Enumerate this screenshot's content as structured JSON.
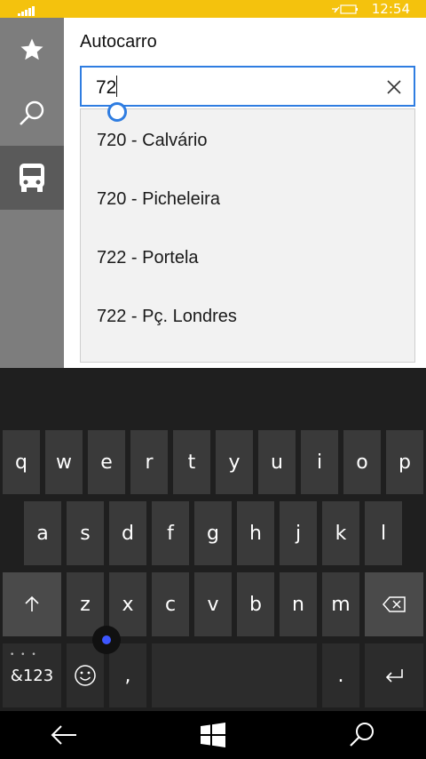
{
  "status_bar": {
    "time": "12:54"
  },
  "sidebar": {
    "items": [
      {
        "icon": "star-icon",
        "label": "Favoritos"
      },
      {
        "icon": "search-icon",
        "label": "Pesquisa"
      },
      {
        "icon": "bus-icon",
        "label": "Autocarro",
        "active": true
      }
    ]
  },
  "panel": {
    "title": "Autocarro",
    "search": {
      "value": "72"
    }
  },
  "suggestions": [
    "720 - Calvário",
    "720 - Picheleira",
    "722 - Portela",
    "722 - Pç. Londres"
  ],
  "keyboard": {
    "row1": [
      "q",
      "w",
      "e",
      "r",
      "t",
      "y",
      "u",
      "i",
      "o",
      "p"
    ],
    "row2": [
      "a",
      "s",
      "d",
      "f",
      "g",
      "h",
      "j",
      "k",
      "l"
    ],
    "row3": [
      "z",
      "x",
      "c",
      "v",
      "b",
      "n",
      "m"
    ],
    "numbers_label": "&123",
    "comma": ",",
    "period": "."
  },
  "colors": {
    "accent": "#2f7de1",
    "status_bar": "#f4c20d",
    "rail": "#7d7d7d"
  }
}
